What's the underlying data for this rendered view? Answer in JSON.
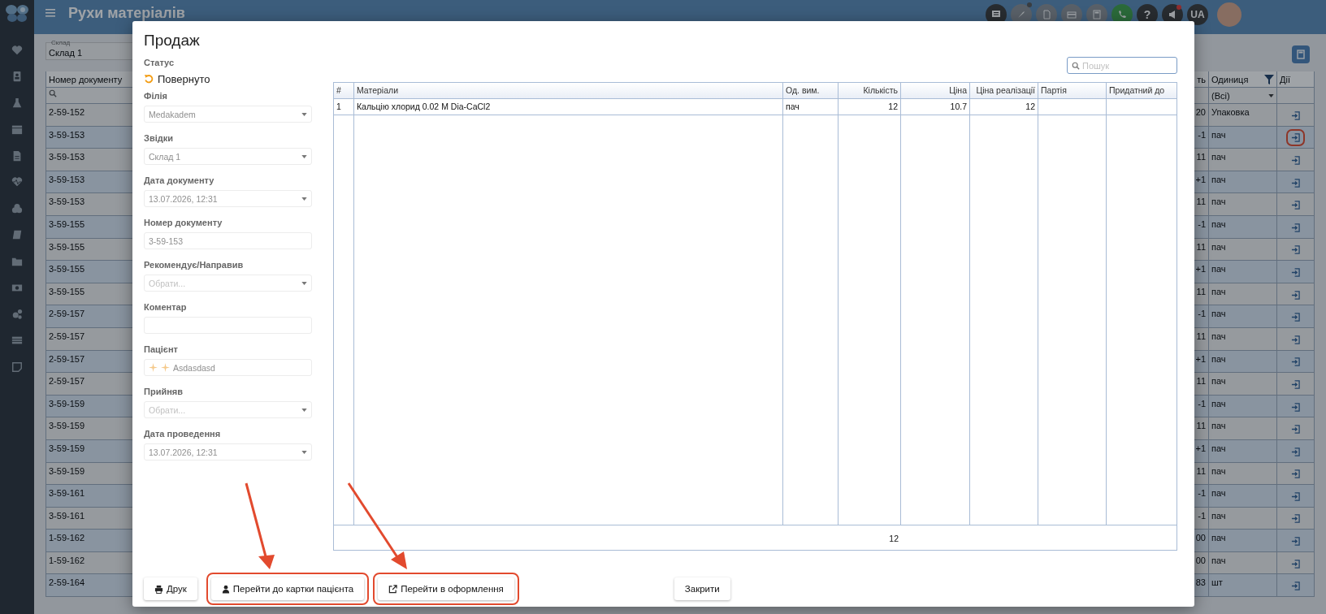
{
  "app_bar": {
    "title": "Рухи матеріалів",
    "help": "?",
    "language": "UA"
  },
  "background": {
    "warehouse_filter": {
      "label": "Склад",
      "value": "Склад 1"
    },
    "columns": [
      "Номер документу",
      "ть",
      "Одиниця",
      "Дії"
    ],
    "unit_filter": "(Всі)",
    "rows": [
      {
        "document": "2-59-152",
        "column_2": "20",
        "unit": "Упаковка",
        "annotated": false
      },
      {
        "document": "3-59-153",
        "column_2": "-1",
        "unit": "пач",
        "annotated": true
      },
      {
        "document": "3-59-153",
        "column_2": "11",
        "unit": "пач",
        "annotated": false
      },
      {
        "document": "3-59-153",
        "column_2": "+1",
        "unit": "пач",
        "annotated": false
      },
      {
        "document": "3-59-153",
        "column_2": "11",
        "unit": "пач",
        "annotated": false
      },
      {
        "document": "3-59-155",
        "column_2": "-1",
        "unit": "пач",
        "annotated": false
      },
      {
        "document": "3-59-155",
        "column_2": "11",
        "unit": "пач",
        "annotated": false
      },
      {
        "document": "3-59-155",
        "column_2": "+1",
        "unit": "пач",
        "annotated": false
      },
      {
        "document": "3-59-155",
        "column_2": "11",
        "unit": "пач",
        "annotated": false
      },
      {
        "document": "2-59-157",
        "column_2": "-1",
        "unit": "пач",
        "annotated": false
      },
      {
        "document": "2-59-157",
        "column_2": "11",
        "unit": "пач",
        "annotated": false
      },
      {
        "document": "2-59-157",
        "column_2": "+1",
        "unit": "пач",
        "annotated": false
      },
      {
        "document": "2-59-157",
        "column_2": "11",
        "unit": "пач",
        "annotated": false
      },
      {
        "document": "3-59-159",
        "column_2": "-1",
        "unit": "пач",
        "annotated": false
      },
      {
        "document": "3-59-159",
        "column_2": "11",
        "unit": "пач",
        "annotated": false
      },
      {
        "document": "3-59-159",
        "column_2": "+1",
        "unit": "пач",
        "annotated": false
      },
      {
        "document": "3-59-159",
        "column_2": "11",
        "unit": "пач",
        "annotated": false
      },
      {
        "document": "3-59-161",
        "column_2": "-1",
        "unit": "пач",
        "annotated": false
      },
      {
        "document": "3-59-161",
        "column_2": "-1",
        "unit": "пач",
        "annotated": false
      },
      {
        "document": "1-59-162",
        "column_2": "00",
        "unit": "пач",
        "annotated": false
      },
      {
        "document": "1-59-162",
        "column_2": "00",
        "unit": "пач",
        "annotated": false
      },
      {
        "document": "2-59-164",
        "column_2": "83",
        "unit": "шт",
        "annotated": false
      }
    ]
  },
  "modal": {
    "title": "Продаж",
    "status": {
      "label": "Статус",
      "value": "Повернуто"
    },
    "fields": [
      {
        "label": "Філія",
        "kind": "select",
        "value": "Medakadem"
      },
      {
        "label": "Звідки",
        "kind": "select",
        "value": "Склад 1"
      },
      {
        "label": "Дата документу",
        "kind": "select",
        "value": "13.07.2026, 12:31"
      },
      {
        "label": "Номер документу",
        "kind": "text",
        "value": "3-59-153"
      },
      {
        "label": "Рекомендує/Направив",
        "kind": "select",
        "placeholder": "Обрати..."
      },
      {
        "label": "Коментар",
        "kind": "text"
      },
      {
        "label": "Пацієнт",
        "kind": "patient",
        "value": "Asdasdasd"
      },
      {
        "label": "Прийняв",
        "kind": "select",
        "placeholder": "Обрати..."
      },
      {
        "label": "Дата проведення",
        "kind": "select",
        "value": "13.07.2026, 12:31"
      }
    ],
    "search": {
      "placeholder": "Пошук"
    },
    "table": {
      "columns": [
        {
          "label": "#",
          "kind": "text"
        },
        {
          "label": "Матеріали",
          "kind": "text"
        },
        {
          "label": "Од. вим.",
          "kind": "text"
        },
        {
          "label": "Кількість",
          "kind": "number"
        },
        {
          "label": "Ціна",
          "kind": "number"
        },
        {
          "label": "Ціна реалізації",
          "kind": "number"
        },
        {
          "label": "Партія",
          "kind": "text"
        },
        {
          "label": "Придатний до",
          "kind": "text"
        }
      ],
      "rows": [
        {
          "cells": [
            "1",
            "Кальцію хлорид 0.02 M Dia-CaCl2",
            "пач",
            "12",
            "10.7",
            "12",
            "",
            ""
          ]
        }
      ],
      "total": "12"
    },
    "buttons": [
      {
        "label": "Друк",
        "kind": "print",
        "annotated": false
      },
      {
        "label": "Перейти до картки пацієнта",
        "kind": "patient",
        "annotated": true
      },
      {
        "label": "Перейти в оформлення",
        "kind": "open",
        "annotated": true
      },
      {
        "label": "Закрити",
        "kind": "close",
        "annotated": false
      }
    ]
  }
}
